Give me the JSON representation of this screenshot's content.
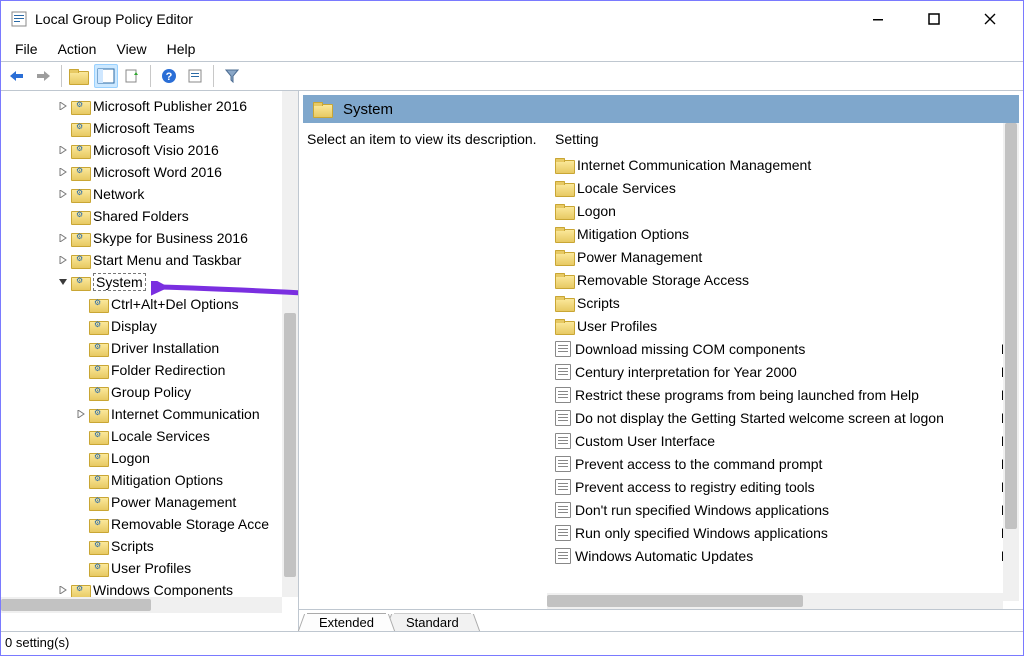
{
  "window": {
    "title": "Local Group Policy Editor"
  },
  "menu": [
    "File",
    "Action",
    "View",
    "Help"
  ],
  "tree": {
    "items": [
      {
        "label": "Microsoft Publisher 2016",
        "depth": 3,
        "expander": ">"
      },
      {
        "label": "Microsoft Teams",
        "depth": 3,
        "expander": ""
      },
      {
        "label": "Microsoft Visio 2016",
        "depth": 3,
        "expander": ">"
      },
      {
        "label": "Microsoft Word 2016",
        "depth": 3,
        "expander": ">"
      },
      {
        "label": "Network",
        "depth": 3,
        "expander": ">"
      },
      {
        "label": "Shared Folders",
        "depth": 3,
        "expander": ""
      },
      {
        "label": "Skype for Business 2016",
        "depth": 3,
        "expander": ">"
      },
      {
        "label": "Start Menu and Taskbar",
        "depth": 3,
        "expander": ">"
      },
      {
        "label": "System",
        "depth": 3,
        "expander": "v",
        "selected": true
      },
      {
        "label": "Ctrl+Alt+Del Options",
        "depth": 4,
        "expander": ""
      },
      {
        "label": "Display",
        "depth": 4,
        "expander": ""
      },
      {
        "label": "Driver Installation",
        "depth": 4,
        "expander": ""
      },
      {
        "label": "Folder Redirection",
        "depth": 4,
        "expander": ""
      },
      {
        "label": "Group Policy",
        "depth": 4,
        "expander": ""
      },
      {
        "label": "Internet Communication",
        "depth": 4,
        "expander": ">"
      },
      {
        "label": "Locale Services",
        "depth": 4,
        "expander": ""
      },
      {
        "label": "Logon",
        "depth": 4,
        "expander": ""
      },
      {
        "label": "Mitigation Options",
        "depth": 4,
        "expander": ""
      },
      {
        "label": "Power Management",
        "depth": 4,
        "expander": ""
      },
      {
        "label": "Removable Storage Acce",
        "depth": 4,
        "expander": ""
      },
      {
        "label": "Scripts",
        "depth": 4,
        "expander": ""
      },
      {
        "label": "User Profiles",
        "depth": 4,
        "expander": ""
      },
      {
        "label": "Windows Components",
        "depth": 3,
        "expander": ">"
      }
    ]
  },
  "details": {
    "header": "System",
    "description": "Select an item to view its description.",
    "column_header": "Setting",
    "items": [
      {
        "label": "Internet Communication Management",
        "type": "folder"
      },
      {
        "label": "Locale Services",
        "type": "folder"
      },
      {
        "label": "Logon",
        "type": "folder"
      },
      {
        "label": "Mitigation Options",
        "type": "folder"
      },
      {
        "label": "Power Management",
        "type": "folder"
      },
      {
        "label": "Removable Storage Access",
        "type": "folder"
      },
      {
        "label": "Scripts",
        "type": "folder"
      },
      {
        "label": "User Profiles",
        "type": "folder"
      },
      {
        "label": "Download missing COM components",
        "type": "policy",
        "state": "N"
      },
      {
        "label": "Century interpretation for Year 2000",
        "type": "policy",
        "state": "N"
      },
      {
        "label": "Restrict these programs from being launched from Help",
        "type": "policy",
        "state": "N"
      },
      {
        "label": "Do not display the Getting Started welcome screen at logon",
        "type": "policy",
        "state": "N"
      },
      {
        "label": "Custom User Interface",
        "type": "policy",
        "state": "N"
      },
      {
        "label": "Prevent access to the command prompt",
        "type": "policy",
        "state": "N"
      },
      {
        "label": "Prevent access to registry editing tools",
        "type": "policy",
        "state": "N"
      },
      {
        "label": "Don't run specified Windows applications",
        "type": "policy",
        "state": "N"
      },
      {
        "label": "Run only specified Windows applications",
        "type": "policy",
        "state": "N"
      },
      {
        "label": "Windows Automatic Updates",
        "type": "policy",
        "state": "N"
      }
    ]
  },
  "tabs": {
    "extended": "Extended",
    "standard": "Standard"
  },
  "status": "0 setting(s)"
}
